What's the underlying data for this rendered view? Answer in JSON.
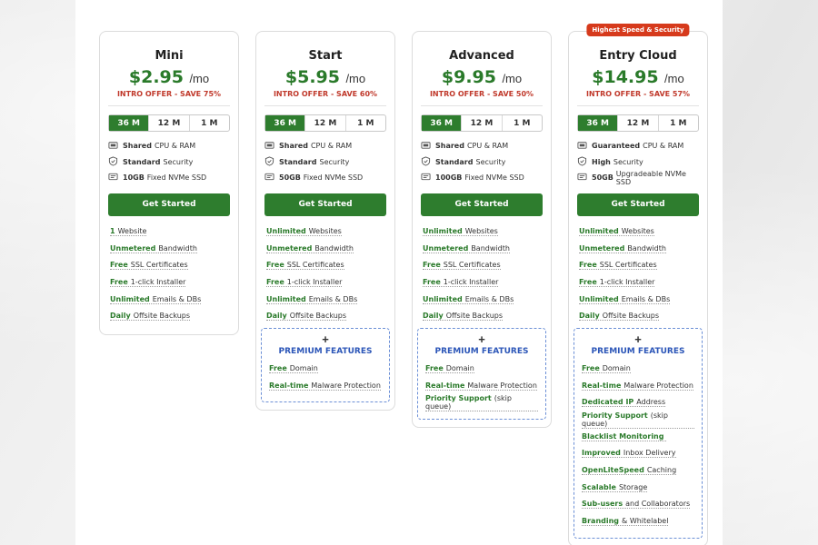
{
  "plans": [
    {
      "name": "Mini",
      "price": "$2.95",
      "per": "/mo",
      "offer": "INTRO OFFER - SAVE 75%",
      "badge": "",
      "terms": [
        "36 M",
        "12 M",
        "1 M"
      ],
      "active_term": "36 M",
      "specs": [
        {
          "icon": "cpu-icon",
          "bold": "Shared",
          "text": "CPU & RAM"
        },
        {
          "icon": "shield-icon",
          "bold": "Standard",
          "text": "Security"
        },
        {
          "icon": "ssd-icon",
          "bold": "10GB",
          "text": "Fixed NVMe SSD"
        }
      ],
      "cta": "Get Started",
      "features": [
        {
          "hl": "1",
          "text": "Website"
        },
        {
          "hl": "Unmetered",
          "text": "Bandwidth"
        },
        {
          "hl": "Free",
          "text": "SSL Certificates"
        },
        {
          "hl": "Free",
          "text": "1-click Installer"
        },
        {
          "hl": "Unlimited",
          "text": "Emails & DBs"
        },
        {
          "hl": "Daily",
          "text": "Offsite Backups"
        }
      ],
      "premium": null
    },
    {
      "name": "Start",
      "price": "$5.95",
      "per": "/mo",
      "offer": "INTRO OFFER - SAVE 60%",
      "badge": "",
      "terms": [
        "36 M",
        "12 M",
        "1 M"
      ],
      "active_term": "36 M",
      "specs": [
        {
          "icon": "cpu-icon",
          "bold": "Shared",
          "text": "CPU & RAM"
        },
        {
          "icon": "shield-icon",
          "bold": "Standard",
          "text": "Security"
        },
        {
          "icon": "ssd-icon",
          "bold": "50GB",
          "text": "Fixed NVMe SSD"
        }
      ],
      "cta": "Get Started",
      "features": [
        {
          "hl": "Unlimited",
          "text": "Websites"
        },
        {
          "hl": "Unmetered",
          "text": "Bandwidth"
        },
        {
          "hl": "Free",
          "text": "SSL Certificates"
        },
        {
          "hl": "Free",
          "text": "1-click Installer"
        },
        {
          "hl": "Unlimited",
          "text": "Emails & DBs"
        },
        {
          "hl": "Daily",
          "text": "Offsite Backups"
        }
      ],
      "premium": {
        "plus": "+",
        "title": "PREMIUM FEATURES",
        "items": [
          {
            "hl": "Free",
            "text": "Domain"
          },
          {
            "hl": "Real-time",
            "text": "Malware Protection"
          }
        ]
      }
    },
    {
      "name": "Advanced",
      "price": "$9.95",
      "per": "/mo",
      "offer": "INTRO OFFER - SAVE 50%",
      "badge": "",
      "terms": [
        "36 M",
        "12 M",
        "1 M"
      ],
      "active_term": "36 M",
      "specs": [
        {
          "icon": "cpu-icon",
          "bold": "Shared",
          "text": "CPU & RAM"
        },
        {
          "icon": "shield-icon",
          "bold": "Standard",
          "text": "Security"
        },
        {
          "icon": "ssd-icon",
          "bold": "100GB",
          "text": "Fixed NVMe SSD"
        }
      ],
      "cta": "Get Started",
      "features": [
        {
          "hl": "Unlimited",
          "text": "Websites"
        },
        {
          "hl": "Unmetered",
          "text": "Bandwidth"
        },
        {
          "hl": "Free",
          "text": "SSL Certificates"
        },
        {
          "hl": "Free",
          "text": "1-click Installer"
        },
        {
          "hl": "Unlimited",
          "text": "Emails & DBs"
        },
        {
          "hl": "Daily",
          "text": "Offsite Backups"
        }
      ],
      "premium": {
        "plus": "+",
        "title": "PREMIUM FEATURES",
        "items": [
          {
            "hl": "Free",
            "text": "Domain"
          },
          {
            "hl": "Real-time",
            "text": "Malware Protection"
          },
          {
            "hl": "Priority Support",
            "text": "(skip queue)"
          }
        ]
      }
    },
    {
      "name": "Entry Cloud",
      "price": "$14.95",
      "per": "/mo",
      "offer": "INTRO OFFER - SAVE 57%",
      "badge": "Highest Speed & Security",
      "terms": [
        "36 M",
        "12 M",
        "1 M"
      ],
      "active_term": "36 M",
      "specs": [
        {
          "icon": "cpu-icon",
          "bold": "Guaranteed",
          "text": "CPU & RAM"
        },
        {
          "icon": "shield-icon",
          "bold": "High",
          "text": "Security"
        },
        {
          "icon": "ssd-icon",
          "bold": "50GB",
          "text": "Upgradeable NVMe SSD"
        }
      ],
      "cta": "Get Started",
      "features": [
        {
          "hl": "Unlimited",
          "text": "Websites"
        },
        {
          "hl": "Unmetered",
          "text": "Bandwidth"
        },
        {
          "hl": "Free",
          "text": "SSL Certificates"
        },
        {
          "hl": "Free",
          "text": "1-click Installer"
        },
        {
          "hl": "Unlimited",
          "text": "Emails & DBs"
        },
        {
          "hl": "Daily",
          "text": "Offsite Backups"
        }
      ],
      "premium": {
        "plus": "+",
        "title": "PREMIUM FEATURES",
        "items": [
          {
            "hl": "Free",
            "text": "Domain"
          },
          {
            "hl": "Real-time",
            "text": "Malware Protection"
          },
          {
            "hl": "Dedicated IP",
            "text": "Address"
          },
          {
            "hl": "Priority Support",
            "text": "(skip queue)"
          },
          {
            "hl": "Blacklist Monitoring",
            "text": ""
          },
          {
            "hl": "Improved",
            "text": "Inbox Delivery"
          },
          {
            "hl": "OpenLiteSpeed",
            "text": "Caching"
          },
          {
            "hl": "Scalable",
            "text": "Storage"
          },
          {
            "hl": "Sub-users",
            "text": "and Collaborators"
          },
          {
            "hl": "Branding",
            "text": "& Whitelabel"
          }
        ]
      }
    }
  ],
  "colors": {
    "accent_green": "#2e7d2e",
    "offer_red": "#c0392b",
    "premium_blue": "#2c56b8",
    "badge_red": "#d63a1c"
  }
}
